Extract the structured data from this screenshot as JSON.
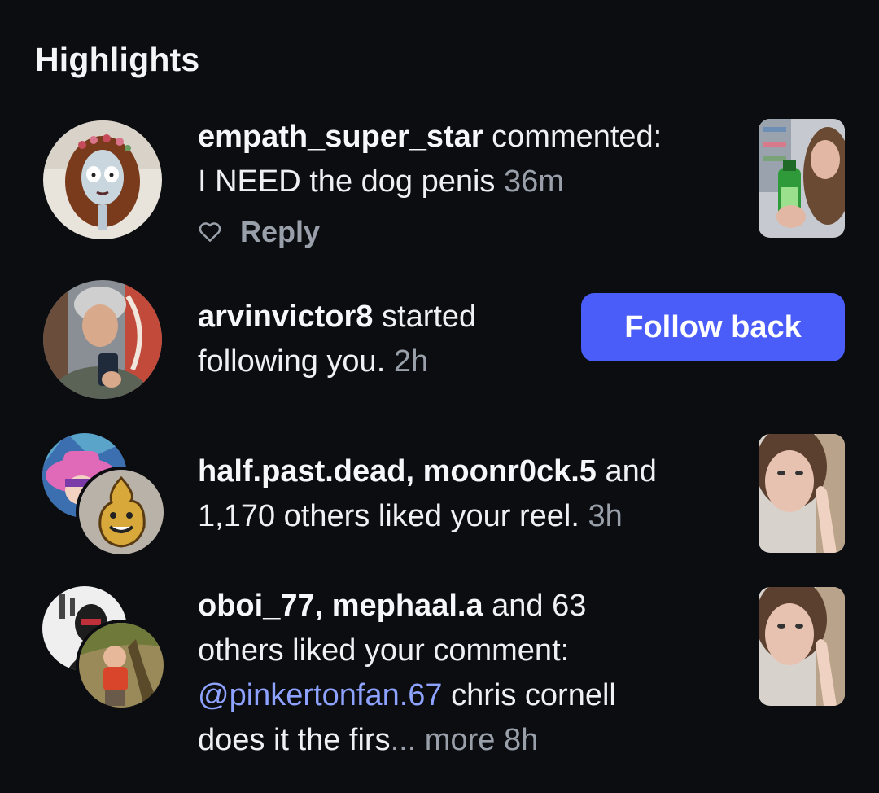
{
  "section": {
    "title": "Highlights"
  },
  "colors": {
    "background": "#0b0d11",
    "accent": "#4a5df9",
    "mention": "#8ea2ff",
    "muted": "#9aa0aa"
  },
  "notifications": [
    {
      "user": "empath_super_star",
      "action": " commented:",
      "line2": "I NEED the dog penis",
      "time": "36m",
      "reply_label": "Reply",
      "like_icon": "heart-outline-icon"
    },
    {
      "user": "arvinvictor8",
      "action": " started",
      "line2": "following you.",
      "time": "2h",
      "button_label": "Follow back"
    },
    {
      "users": "half.past.dead, moonr0ck.5",
      "action": " and",
      "line2": "1,170 others liked your reel.",
      "time": "3h"
    },
    {
      "users": "oboi_77, mephaal.a",
      "action": " and 63",
      "line2": "others liked your comment:",
      "mention": "@pinkertonfan.67",
      "line3_rest": " chris cornell",
      "line4": "does it the firs",
      "more": "... more",
      "time": "8h"
    }
  ]
}
